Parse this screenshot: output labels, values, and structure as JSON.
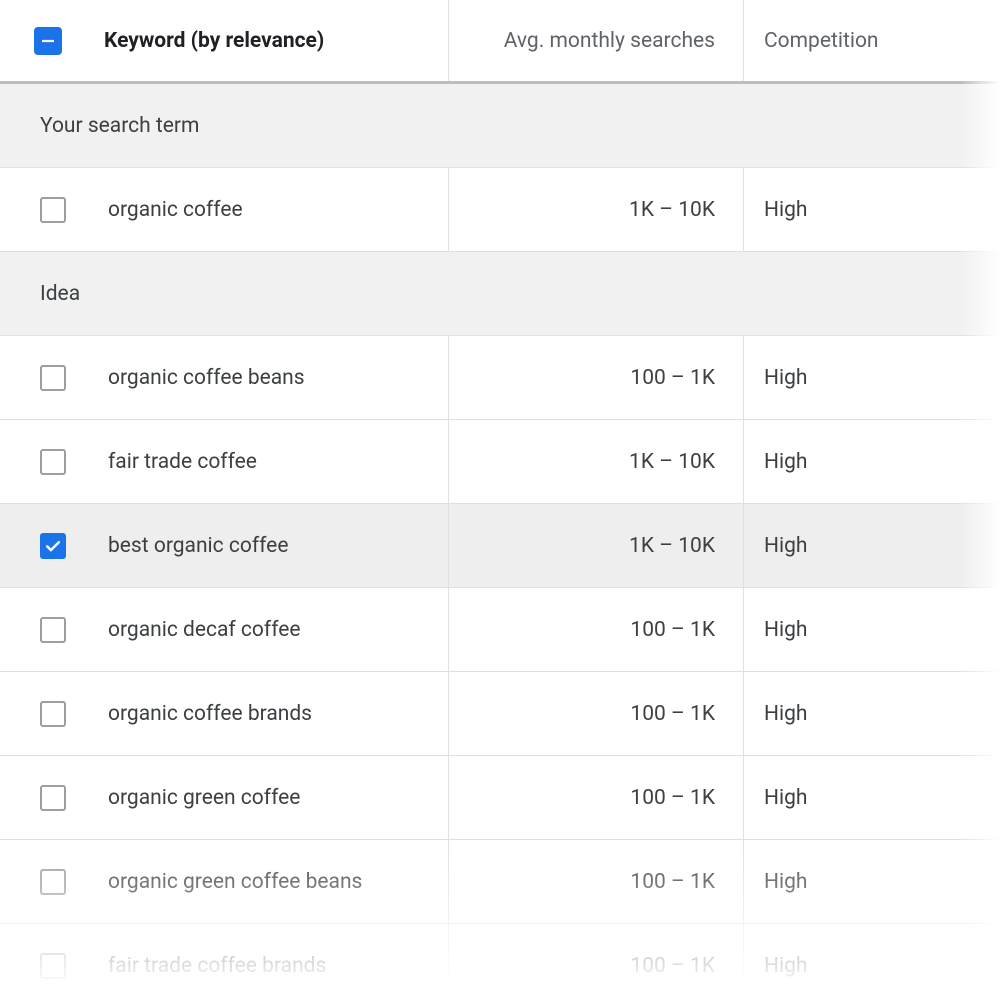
{
  "columns": {
    "keyword": "Keyword (by relevance)",
    "searches": "Avg. monthly searches",
    "competition": "Competition"
  },
  "sections": [
    {
      "title": "Your search term",
      "rows": [
        {
          "keyword": "organic coffee",
          "searches": "1K – 10K",
          "competition": "High",
          "checked": false
        }
      ]
    },
    {
      "title": "Idea",
      "rows": [
        {
          "keyword": "organic coffee beans",
          "searches": "100 – 1K",
          "competition": "High",
          "checked": false
        },
        {
          "keyword": "fair trade coffee",
          "searches": "1K – 10K",
          "competition": "High",
          "checked": false
        },
        {
          "keyword": "best organic coffee",
          "searches": "1K – 10K",
          "competition": "High",
          "checked": true
        },
        {
          "keyword": "organic decaf coffee",
          "searches": "100 – 1K",
          "competition": "High",
          "checked": false
        },
        {
          "keyword": "organic coffee brands",
          "searches": "100 – 1K",
          "competition": "High",
          "checked": false
        },
        {
          "keyword": "organic green coffee",
          "searches": "100 – 1K",
          "competition": "High",
          "checked": false
        },
        {
          "keyword": "organic green coffee beans",
          "searches": "100 – 1K",
          "competition": "High",
          "checked": false
        },
        {
          "keyword": "fair trade coffee brands",
          "searches": "100 – 1K",
          "competition": "High",
          "checked": false
        }
      ]
    }
  ]
}
